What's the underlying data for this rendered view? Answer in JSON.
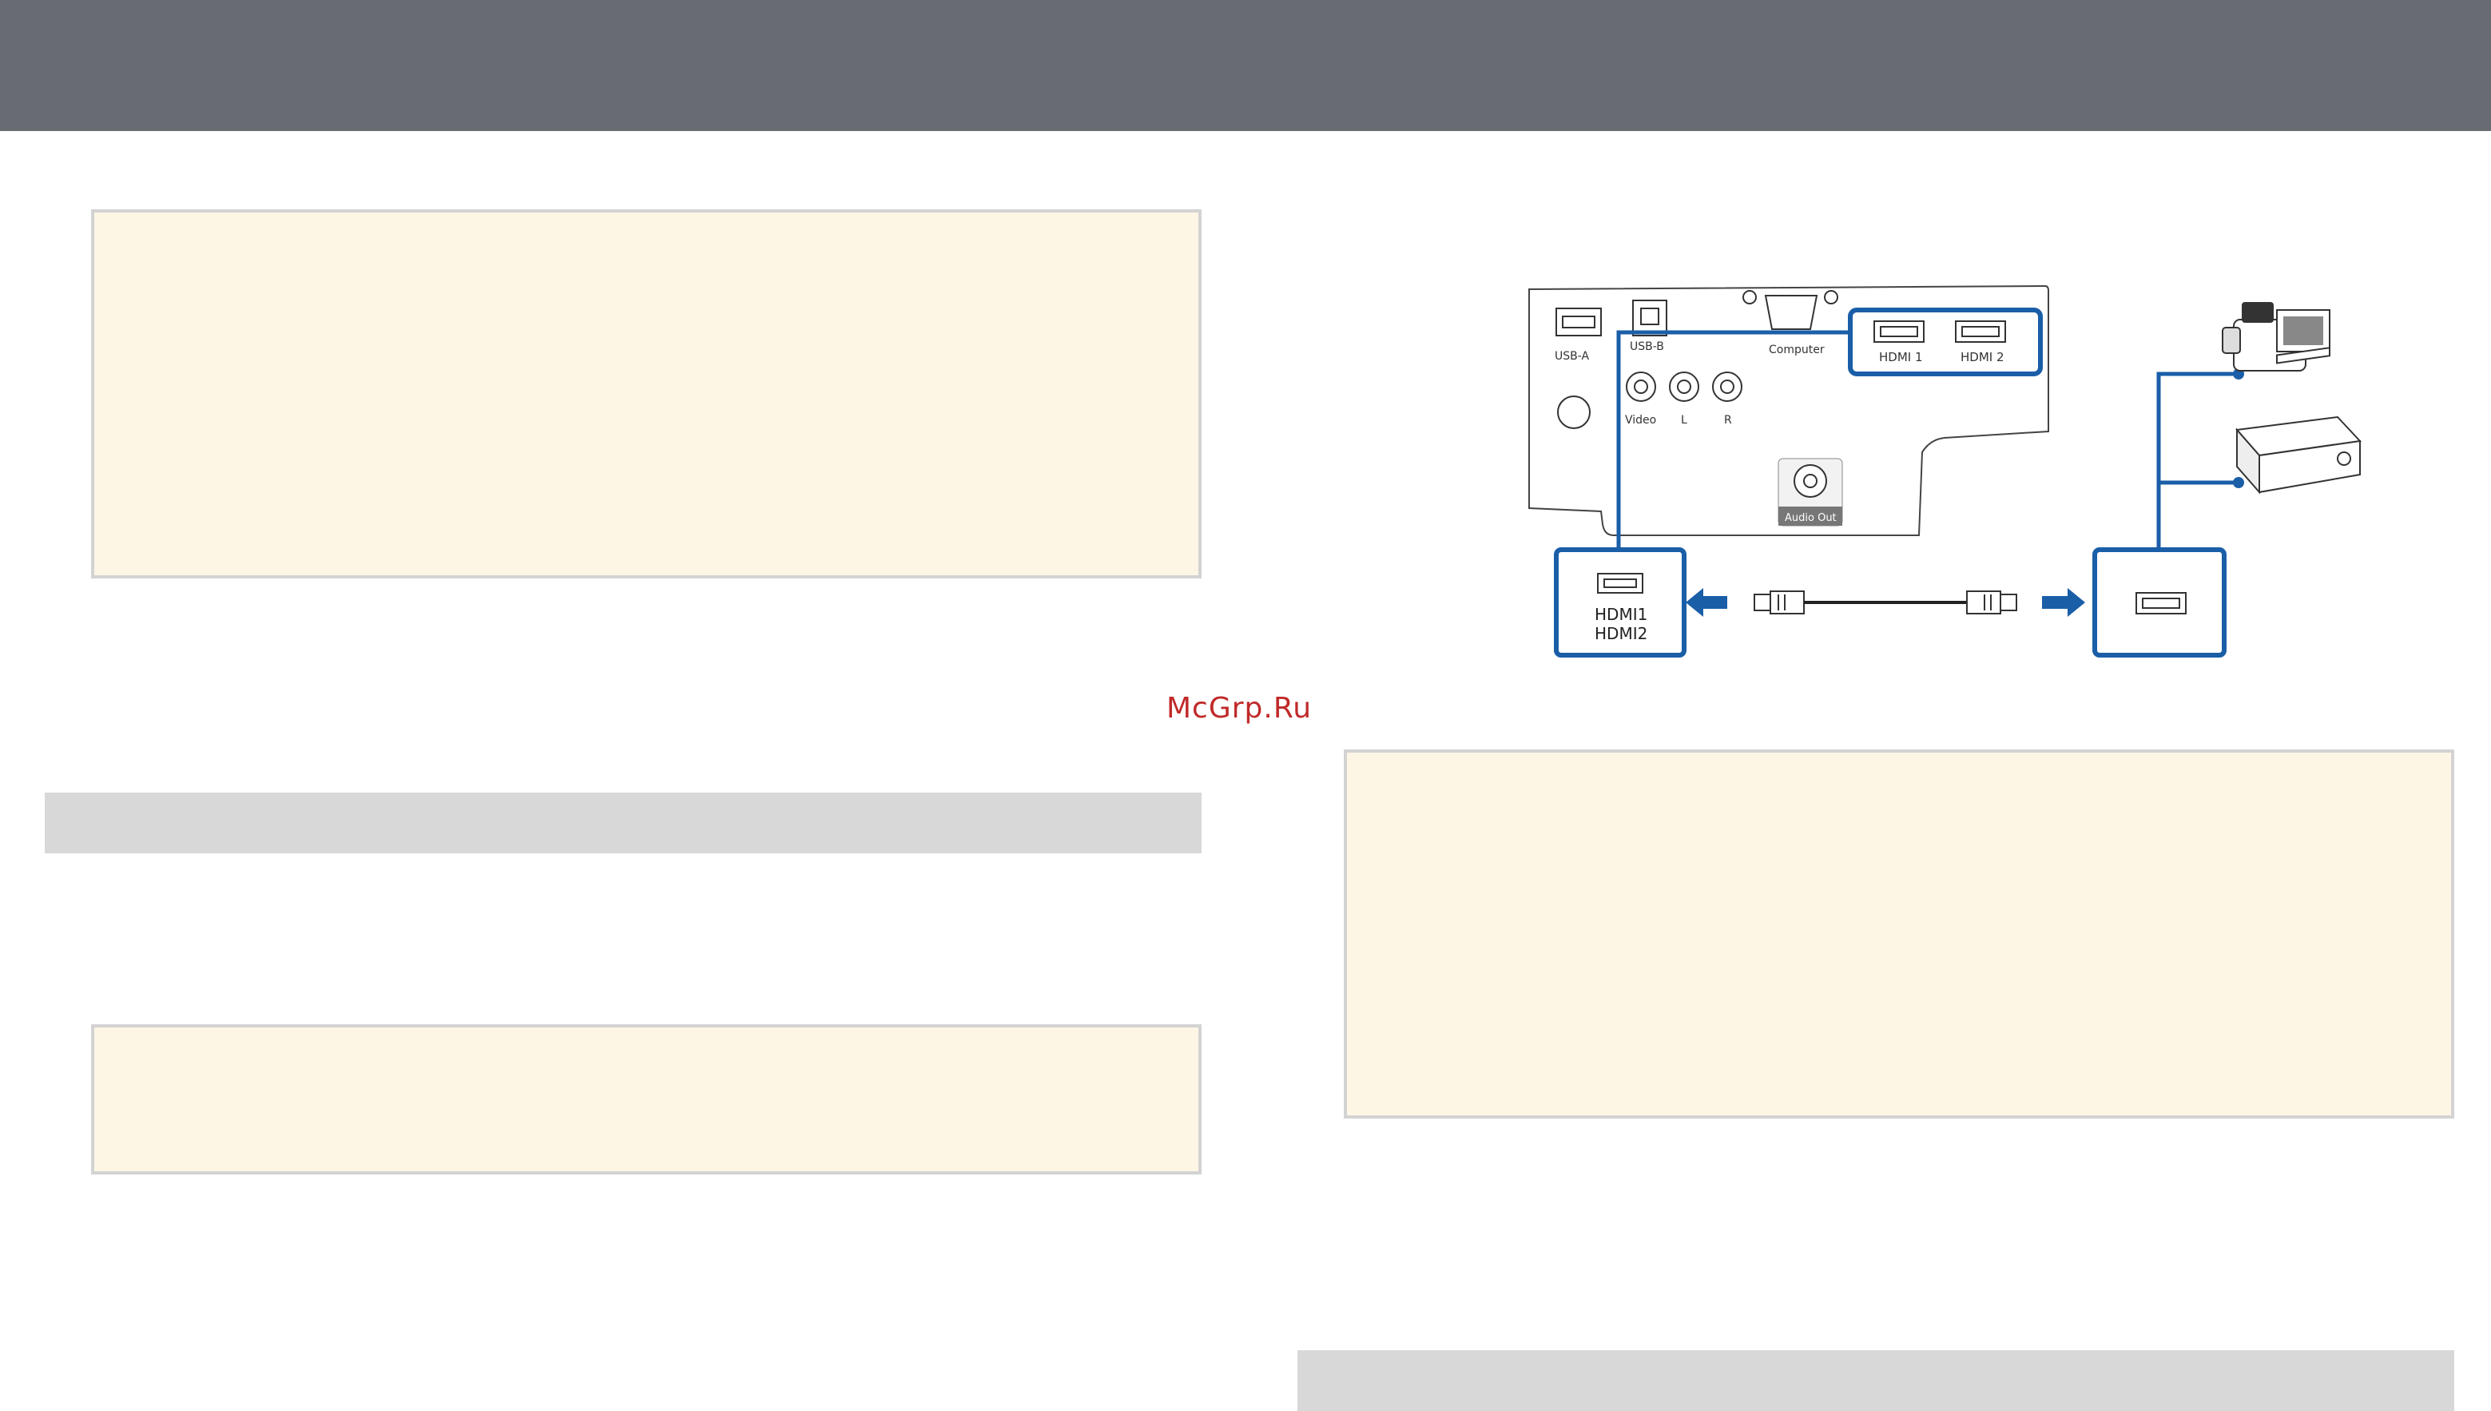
{
  "watermark": "McGrp.Ru",
  "diagram": {
    "ports": {
      "usb_a": "USB-A",
      "usb_b": "USB-B",
      "computer": "Computer",
      "hdmi1": "HDMI 1",
      "hdmi2": "HDMI 2",
      "video": "Video",
      "audio_l": "L",
      "audio_r": "R",
      "audio_out": "Audio Out"
    },
    "callout_label_line1": "HDMI1",
    "callout_label_line2": "HDMI2"
  },
  "colors": {
    "header": "#696b73",
    "accent_blue": "#1a5ea8",
    "note_background": "#fdf6e5",
    "note_border": "#d3d3d3",
    "section_bar": "#d8d8d8",
    "watermark": "#c02a2a"
  }
}
